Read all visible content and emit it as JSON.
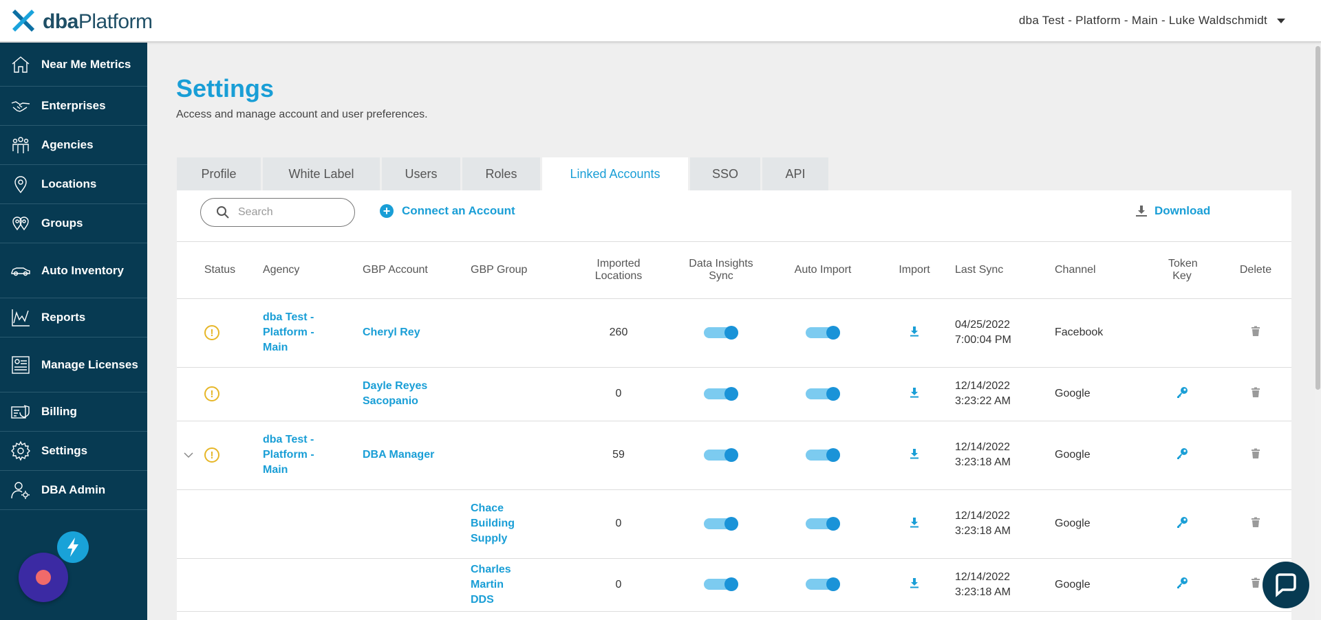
{
  "app": {
    "logo_bold": "dba",
    "logo_rest": "Platform"
  },
  "header": {
    "account_label": "dba Test - Platform - Main - Luke Waldschmidt"
  },
  "sidebar": {
    "items": [
      {
        "label": "Near Me Metrics",
        "icon": "home-icon"
      },
      {
        "label": "Enterprises",
        "icon": "handshake-icon"
      },
      {
        "label": "Agencies",
        "icon": "people-group-icon"
      },
      {
        "label": "Locations",
        "icon": "map-pin-icon"
      },
      {
        "label": "Groups",
        "icon": "multi-pin-icon"
      },
      {
        "label": "Auto Inventory",
        "icon": "car-icon"
      },
      {
        "label": "Reports",
        "icon": "line-chart-icon"
      },
      {
        "label": "Manage Licenses",
        "icon": "license-icon"
      },
      {
        "label": "Billing",
        "icon": "billing-icon"
      },
      {
        "label": "Settings",
        "icon": "gear-icon"
      },
      {
        "label": "DBA Admin",
        "icon": "admin-user-icon"
      }
    ]
  },
  "page": {
    "title": "Settings",
    "subtitle": "Access and manage account and user preferences."
  },
  "tabs": [
    {
      "label": "Profile",
      "active": false
    },
    {
      "label": "White Label",
      "active": false
    },
    {
      "label": "Users",
      "active": false
    },
    {
      "label": "Roles",
      "active": false
    },
    {
      "label": "Linked Accounts",
      "active": true
    },
    {
      "label": "SSO",
      "active": false
    },
    {
      "label": "API",
      "active": false
    }
  ],
  "toolbar": {
    "search_placeholder": "Search",
    "connect_label": "Connect an Account",
    "download_label": "Download"
  },
  "table": {
    "columns": [
      "Status",
      "Agency",
      "GBP Account",
      "GBP Group",
      "Imported Locations",
      "Data Insights Sync",
      "Auto Import",
      "Import",
      "Last Sync",
      "Channel",
      "Token Key",
      "Delete"
    ],
    "rows": [
      {
        "expander": false,
        "status": "warning",
        "agency": "dba Test - Platform - Main",
        "gbp_account": "Cheryl Rey",
        "gbp_group": "",
        "imported": "260",
        "data_insights_on": true,
        "auto_import_on": true,
        "sync_date": "04/25/2022",
        "sync_time": "7:00:04 PM",
        "channel": "Facebook",
        "token_key": false
      },
      {
        "expander": false,
        "status": "warning",
        "agency": "",
        "gbp_account": "Dayle Reyes Sacopanio",
        "gbp_group": "",
        "imported": "0",
        "data_insights_on": true,
        "auto_import_on": true,
        "sync_date": "12/14/2022",
        "sync_time": "3:23:22 AM",
        "channel": "Google",
        "token_key": true
      },
      {
        "expander": true,
        "status": "warning",
        "agency": "dba Test - Platform - Main",
        "gbp_account": "DBA Manager",
        "gbp_group": "",
        "imported": "59",
        "data_insights_on": true,
        "auto_import_on": true,
        "sync_date": "12/14/2022",
        "sync_time": "3:23:18 AM",
        "channel": "Google",
        "token_key": true
      },
      {
        "expander": false,
        "status": "",
        "agency": "",
        "gbp_account": "",
        "gbp_group": "Chace Building Supply",
        "imported": "0",
        "data_insights_on": true,
        "auto_import_on": true,
        "sync_date": "12/14/2022",
        "sync_time": "3:23:18 AM",
        "channel": "Google",
        "token_key": true
      },
      {
        "expander": false,
        "status": "",
        "agency": "",
        "gbp_account": "",
        "gbp_group": "Charles Martin DDS",
        "imported": "0",
        "data_insights_on": true,
        "auto_import_on": true,
        "sync_date": "12/14/2022",
        "sync_time": "3:23:18 AM",
        "channel": "Google",
        "token_key": true
      }
    ]
  },
  "colors": {
    "brand_blue": "#199ed6",
    "sidebar_bg": "#073a52",
    "warning": "#e6b627",
    "toggle_track": "#7ccbf0",
    "toggle_knob": "#1a93d8"
  }
}
